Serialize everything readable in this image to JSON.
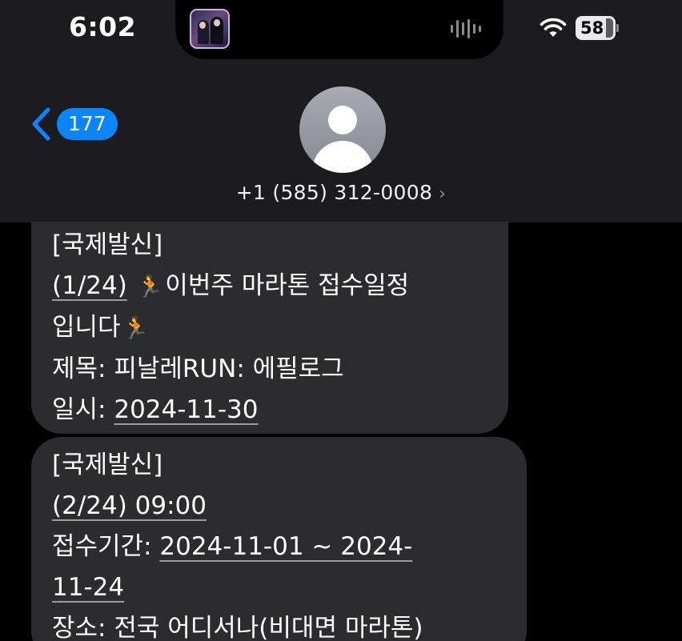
{
  "status_bar": {
    "time": "6:02",
    "battery": "58"
  },
  "nav": {
    "back_count": "177",
    "contact_number": "+1 (585) 312-0008",
    "contact_chevron": "›"
  },
  "messages": [
    {
      "lines": [
        {
          "plain": "[국제발신]"
        },
        {
          "link": "(1/24)",
          "emoji": "🏃",
          "text": "이번주 마라톤 접수일정"
        },
        {
          "plain": "입니다",
          "emoji": "🏃"
        },
        {
          "plain": "제목: 피날레RUN: 에필로그"
        },
        {
          "label": "일시: ",
          "link": "2024-11-30"
        }
      ]
    },
    {
      "lines": [
        {
          "plain": "[국제발신]"
        },
        {
          "link": "(2/24) 09:00"
        },
        {
          "label": "접수기간: ",
          "link": "2024-11-01 ~ 2024-"
        },
        {
          "link": "11-24"
        },
        {
          "plain": "장소: 전국 어디서나(비대면 마라톤)"
        }
      ]
    }
  ],
  "colors": {
    "accent": "#0a84ff",
    "bubble": "#2c2c2e",
    "header_bg": "#1c1c1e"
  }
}
